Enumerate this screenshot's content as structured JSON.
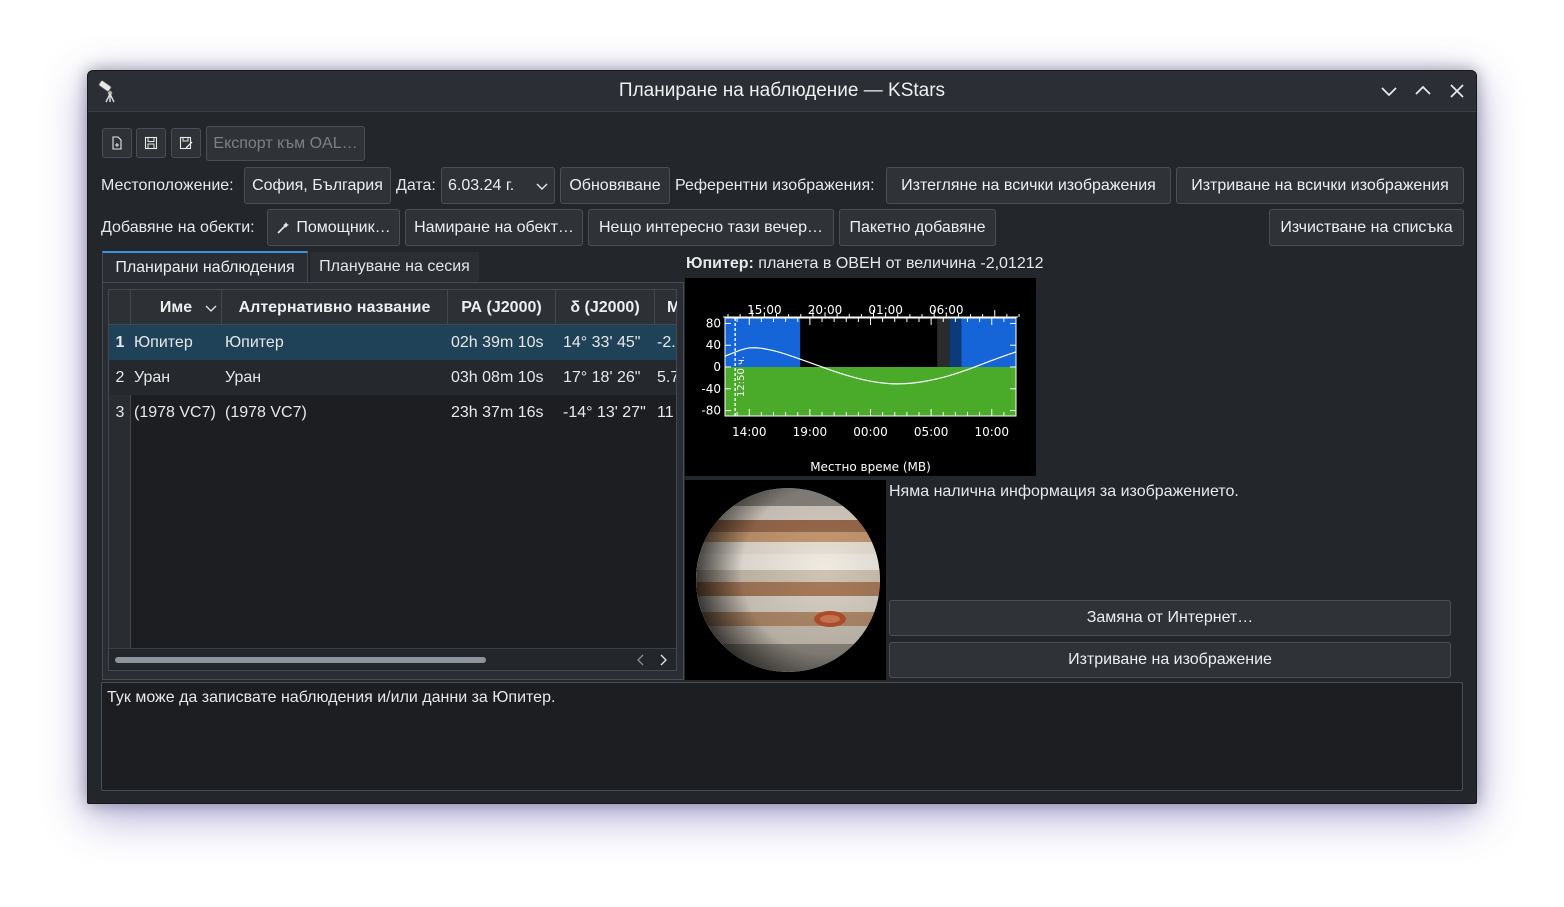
{
  "window": {
    "title": "Планиране на наблюдение — KStars"
  },
  "toolbar": {
    "icons": [
      "new-file-icon",
      "save-icon",
      "save-as-icon"
    ],
    "export_label": "Експорт към OAL…"
  },
  "location_row": {
    "location_label": "Местоположение:",
    "location_value": "София, България",
    "date_label": "Дата:",
    "date_value": "6.03.24 г.",
    "refresh_label": "Обновяване",
    "ref_images_label": "Референтни изображения:",
    "download_all_label": "Изтегляне на всички изображения",
    "delete_all_label": "Изтриване на всички изображения"
  },
  "add_row": {
    "add_label": "Добавяне на обекти:",
    "wizard_label": "Помощник…",
    "find_label": "Намиране на обект…",
    "interesting_label": "Нещо интересно тази вечер…",
    "batch_label": "Пакетно добавяне",
    "clear_label": "Изчистване на списъка"
  },
  "tabs": [
    {
      "label": "Планирани наблюдения",
      "active": true
    },
    {
      "label": "Плануване на сесия",
      "active": false
    }
  ],
  "table": {
    "headers": [
      "Име",
      "Алтернативно название",
      "РА (J2000)",
      "δ (J2000)",
      "М"
    ],
    "rows": [
      {
        "n": "1",
        "name": "Юпитер",
        "alt": "Юпитер",
        "ra": "02h 39m 10s",
        "dec": "14° 33' 45\"",
        "mag": "-2."
      },
      {
        "n": "2",
        "name": "Уран",
        "alt": "Уран",
        "ra": "03h 08m 10s",
        "dec": "17° 18' 26\"",
        "mag": "5.7"
      },
      {
        "n": "3",
        "name": "(1978 VC7)",
        "alt": "(1978 VC7)",
        "ra": "23h 37m 16s",
        "dec": "-14° 13' 27\"",
        "mag": "11"
      }
    ]
  },
  "object_info": {
    "name": "Юпитер:",
    "desc": "планета в ОВЕН от величина -2,01212"
  },
  "chart_data": {
    "type": "line",
    "title": "",
    "xlabel": "Местно време (МВ)",
    "ylabel": "",
    "ylim": [
      -90,
      90
    ],
    "y_ticks": [
      "80",
      "40",
      "0",
      "-40",
      "-80"
    ],
    "x_ticks_bottom": [
      "14:00",
      "19:00",
      "00:00",
      "05:00",
      "10:00"
    ],
    "x_ticks_top": [
      "15:00",
      "20:00",
      "01:00",
      "06:00"
    ],
    "current_time_label": "12:50 ч.",
    "series": [
      {
        "x": [
          12,
          14,
          16,
          18,
          20,
          22,
          24,
          26,
          28,
          30,
          32,
          34,
          36
        ],
        "values": [
          20,
          35,
          30,
          16,
          0,
          -15,
          -26,
          -31,
          -28,
          -19,
          -5,
          12,
          28
        ]
      }
    ],
    "colors": {
      "sky_day": "#1565d8",
      "night": "#000000",
      "ground": "#4aaa2a",
      "curve": "#ffffff"
    }
  },
  "image_panel": {
    "info_text": "Няма налична информация за изображението.",
    "replace_label": "Замяна от Интернет…",
    "delete_label": "Изтриване на изображение"
  },
  "notes": {
    "text": "Тук може да записвате наблюдения и/или данни за Юпитер."
  },
  "colors": {
    "accent": "#3d94d8",
    "selected_row": "#1f4258",
    "window_bg": "#23262b"
  }
}
